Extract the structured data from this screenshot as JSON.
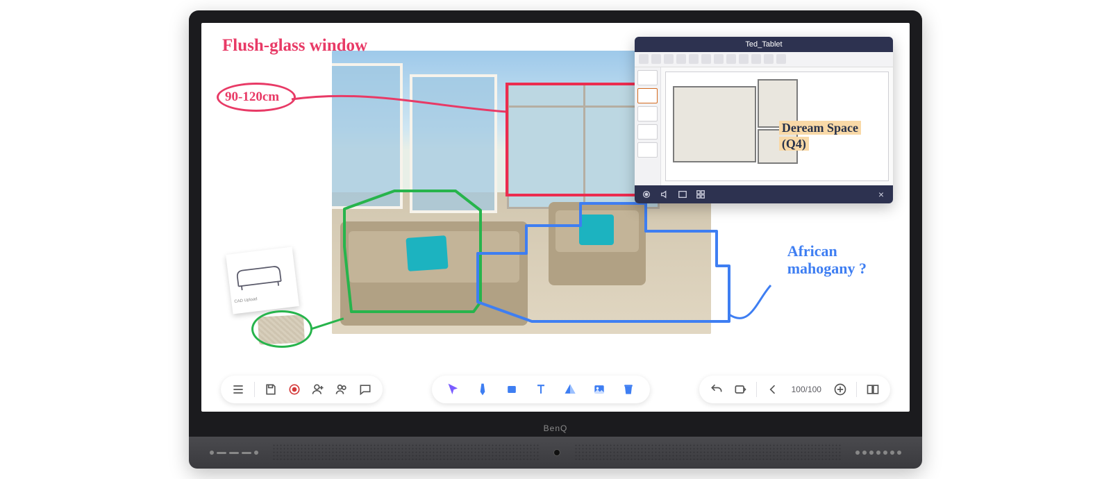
{
  "device": {
    "brand": "BenQ"
  },
  "annotations": {
    "title": "Flush-glass window",
    "dimension": "90-120cm",
    "mahogany_l1": "African",
    "mahogany_l2": "mahogany ?",
    "dream_l1": "Deream Space",
    "dream_l2": "(Q4)"
  },
  "sticky": {
    "caption": "CAD Upload"
  },
  "tablet_window": {
    "title": "Ted_Tablet",
    "close_tooltip": "Close"
  },
  "toolbar": {
    "left": {
      "menu": "Menu",
      "save": "Save",
      "record": "Record",
      "add_user": "Add participant",
      "group": "Participants",
      "comment": "Comment"
    },
    "center": {
      "select": "Select",
      "pen": "Pen",
      "eraser": "Eraser",
      "text": "Text",
      "shape": "Shape",
      "image": "Insert image",
      "delete": "Delete"
    },
    "right": {
      "undo": "Undo",
      "redo": "Redo",
      "prev": "Previous page",
      "page": "100/100",
      "add_page": "Add page",
      "overview": "Page overview"
    }
  },
  "colors": {
    "pink": "#e83a66",
    "blue": "#3e7ef2",
    "green": "#27b44c",
    "red_highlight": "#ec2c4f"
  }
}
